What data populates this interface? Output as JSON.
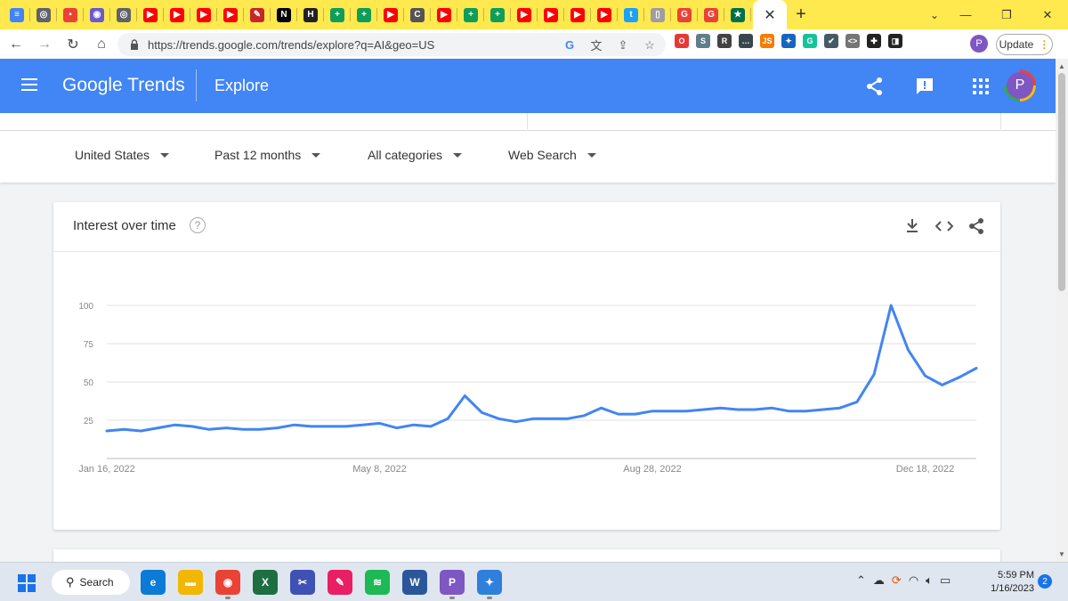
{
  "browser": {
    "tabs": [
      {
        "icon": "docs-icon",
        "color": "#4285f4",
        "glyph": "≡"
      },
      {
        "icon": "chrome-web-icon",
        "color": "#5f6368",
        "glyph": "◎"
      },
      {
        "icon": "apps-icon",
        "color": "#ea4335",
        "glyph": "▪"
      },
      {
        "icon": "circle-logo-icon",
        "color": "#6a5acd",
        "glyph": "◉"
      },
      {
        "icon": "chrome-web-icon",
        "color": "#5f6368",
        "glyph": "◎"
      },
      {
        "icon": "youtube-icon",
        "color": "#ff0000",
        "glyph": "▶"
      },
      {
        "icon": "youtube-icon",
        "color": "#ff0000",
        "glyph": "▶"
      },
      {
        "icon": "youtube-icon",
        "color": "#ff0000",
        "glyph": "▶"
      },
      {
        "icon": "youtube-icon",
        "color": "#ff0000",
        "glyph": "▶"
      },
      {
        "icon": "pen-icon",
        "color": "#c62828",
        "glyph": "✎"
      },
      {
        "icon": "notion-icon",
        "color": "#000000",
        "glyph": "N"
      },
      {
        "icon": "h-logo-icon",
        "color": "#222222",
        "glyph": "H"
      },
      {
        "icon": "sheets-icon",
        "color": "#0f9d58",
        "glyph": "+"
      },
      {
        "icon": "sheets-icon",
        "color": "#0f9d58",
        "glyph": "+"
      },
      {
        "icon": "youtube-icon",
        "color": "#ff0000",
        "glyph": "▶"
      },
      {
        "icon": "terminal-icon",
        "color": "#555555",
        "glyph": "C"
      },
      {
        "icon": "youtube-icon",
        "color": "#ff0000",
        "glyph": "▶"
      },
      {
        "icon": "sheets-icon",
        "color": "#0f9d58",
        "glyph": "+"
      },
      {
        "icon": "sheets-icon",
        "color": "#0f9d58",
        "glyph": "+"
      },
      {
        "icon": "youtube-icon",
        "color": "#ff0000",
        "glyph": "▶"
      },
      {
        "icon": "youtube-icon",
        "color": "#ff0000",
        "glyph": "▶"
      },
      {
        "icon": "youtube-icon",
        "color": "#ff0000",
        "glyph": "▶"
      },
      {
        "icon": "youtube-icon",
        "color": "#ff0000",
        "glyph": "▶"
      },
      {
        "icon": "twitter-icon",
        "color": "#1da1f2",
        "glyph": "t"
      },
      {
        "icon": "doc-page-icon",
        "color": "#9e9e9e",
        "glyph": "▯"
      },
      {
        "icon": "google-icon",
        "color": "#ea4335",
        "glyph": "G"
      },
      {
        "icon": "google-icon",
        "color": "#ea4335",
        "glyph": "G"
      },
      {
        "icon": "starbucks-icon",
        "color": "#00704a",
        "glyph": "★"
      }
    ],
    "active_tab_close": "✕",
    "new_tab": "+",
    "url": "https://trends.google.com/trends/explore?q=AI&geo=US",
    "update_label": "Update",
    "profile_initial": "P",
    "extensions": [
      {
        "icon": "opera-icon",
        "color": "#e53935",
        "glyph": "O"
      },
      {
        "icon": "skype-icon",
        "color": "#607d8b",
        "glyph": "S"
      },
      {
        "icon": "reader-icon",
        "color": "#424242",
        "glyph": "R"
      },
      {
        "icon": "dots-extension-icon",
        "color": "#37474f",
        "glyph": "…"
      },
      {
        "icon": "js-icon",
        "color": "#f57c00",
        "glyph": "JS"
      },
      {
        "icon": "star-extension-icon",
        "color": "#1565c0",
        "glyph": "✦"
      },
      {
        "icon": "grammarly-icon",
        "color": "#15c39a",
        "glyph": "G"
      },
      {
        "icon": "check-extension-icon",
        "color": "#455a64",
        "glyph": "✔"
      },
      {
        "icon": "code-extension-icon",
        "color": "#757575",
        "glyph": "<>"
      },
      {
        "icon": "puzzle-icon",
        "color": "#222222",
        "glyph": "✚"
      },
      {
        "icon": "sidepanel-icon",
        "color": "#222222",
        "glyph": "◨"
      }
    ]
  },
  "trends": {
    "logo": "Google Trends",
    "section": "Explore",
    "profile_initial": "P",
    "filters": {
      "region": "United States",
      "time": "Past 12 months",
      "category": "All categories",
      "search_type": "Web Search"
    },
    "card_title": "Interest over time",
    "help": "?"
  },
  "chart_data": {
    "type": "line",
    "y_ticks": [
      "100",
      "75",
      "50",
      "25"
    ],
    "ylim": [
      0,
      100
    ],
    "x_tick_labels": [
      "Jan 16, 2022",
      "May 8, 2022",
      "Aug 28, 2022",
      "Dec 18, 2022"
    ],
    "series": [
      {
        "color": "#4285f4",
        "values": [
          18,
          19,
          18,
          20,
          22,
          21,
          19,
          20,
          19,
          19,
          20,
          22,
          21,
          21,
          21,
          22,
          23,
          20,
          22,
          21,
          26,
          41,
          30,
          26,
          24,
          26,
          26,
          26,
          28,
          33,
          29,
          29,
          31,
          31,
          31,
          32,
          33,
          32,
          32,
          33,
          31,
          31,
          32,
          33,
          37,
          55,
          100,
          71,
          54,
          48,
          53,
          59
        ]
      }
    ],
    "grid": true
  },
  "taskbar": {
    "search_label": "Search",
    "time": "5:59 PM",
    "date": "1/16/2023",
    "notifications": "2",
    "apps": [
      {
        "name": "edge-icon",
        "color": "#0c7bd6",
        "glyph": "e"
      },
      {
        "name": "file-explorer-icon",
        "color": "#f2b705",
        "glyph": "▬"
      },
      {
        "name": "chrome-icon",
        "color": "#ea4335",
        "glyph": "◉"
      },
      {
        "name": "excel-icon",
        "color": "#1d6f42",
        "glyph": "X"
      },
      {
        "name": "snipping-icon",
        "color": "#3f51b5",
        "glyph": "✂"
      },
      {
        "name": "paint-icon",
        "color": "#e91e63",
        "glyph": "✎"
      },
      {
        "name": "spotify-icon",
        "color": "#1db954",
        "glyph": "≋"
      },
      {
        "name": "word-icon",
        "color": "#2b579a",
        "glyph": "W"
      },
      {
        "name": "chrome-profile-icon",
        "color": "#7e57c2",
        "glyph": "P"
      },
      {
        "name": "teams-icon",
        "color": "#2f7fdc",
        "glyph": "✦"
      }
    ]
  }
}
